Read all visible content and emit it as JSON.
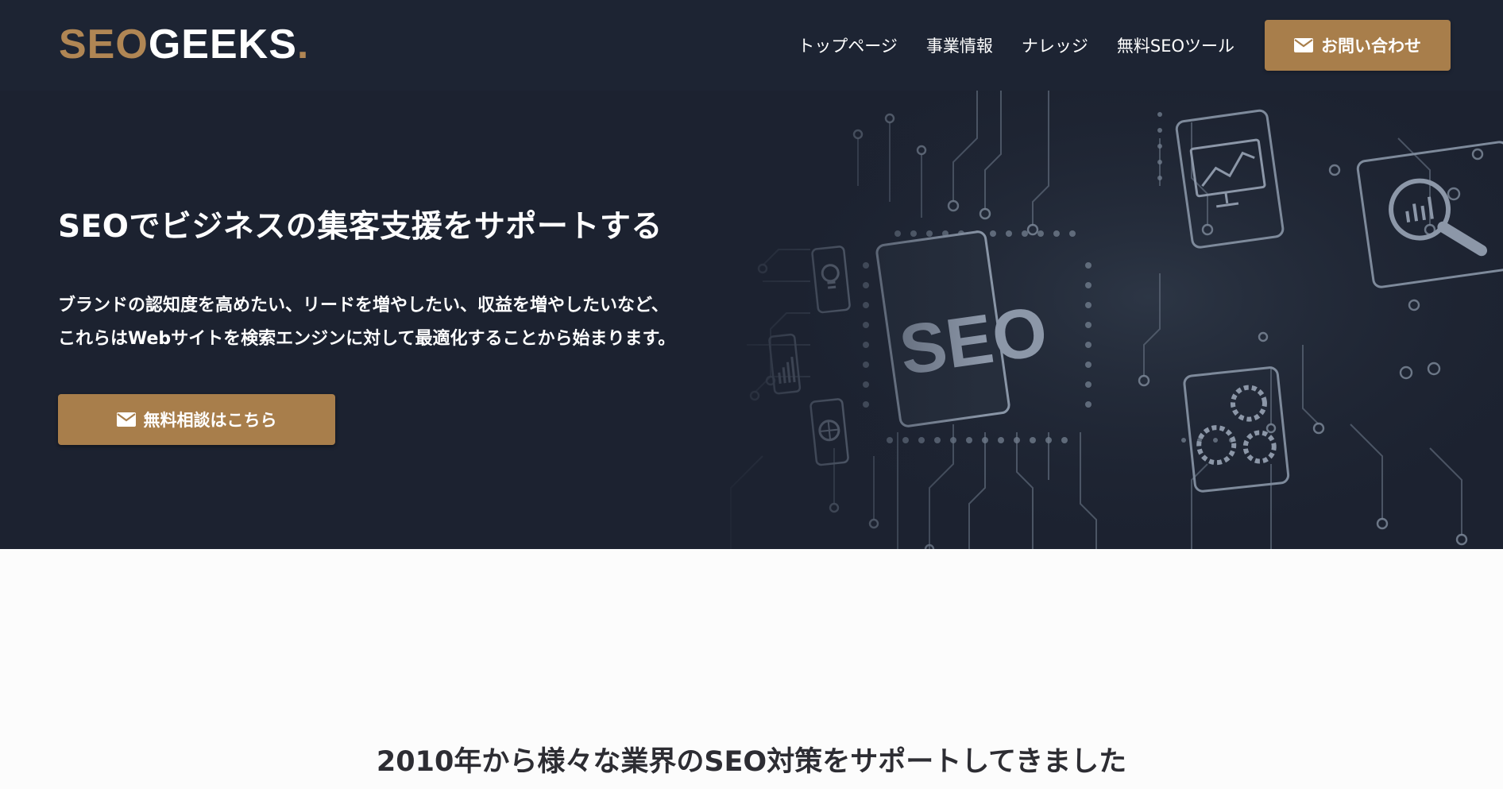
{
  "header": {
    "logo": {
      "part1": "SEO",
      "part2": "GEEKS",
      "part3": "."
    },
    "nav": [
      {
        "label": "トップページ"
      },
      {
        "label": "事業情報"
      },
      {
        "label": "ナレッジ"
      },
      {
        "label": "無料SEOツール"
      }
    ],
    "contact_label": "お問い合わせ"
  },
  "hero": {
    "title": "SEOでビジネスの集客支援をサポートする",
    "description_lines": [
      "ブランドの認知度を高めたい、リードを増やしたい、収益を増やしたいなど、",
      "これらはWebサイトを検索エンジンに対して最適化することから始まります。"
    ],
    "cta_label": "無料相談はこちら",
    "art_text": "SEO"
  },
  "section": {
    "title": "2010年から様々な業界のSEO対策をサポートしてきました"
  },
  "colors": {
    "header_bg": "#1d2433",
    "hero_bg": "#1c2230",
    "accent": "#a87e4b",
    "logo_accent": "#b08654",
    "page_bg": "#fcfcfc",
    "section_text": "#2d2d33"
  },
  "icons": [
    "mail-icon",
    "lightbulb-icon",
    "bar-chart-icon",
    "globe-icon",
    "monitor-chart-icon",
    "magnifier-chart-icon",
    "gear-cart-icon"
  ]
}
